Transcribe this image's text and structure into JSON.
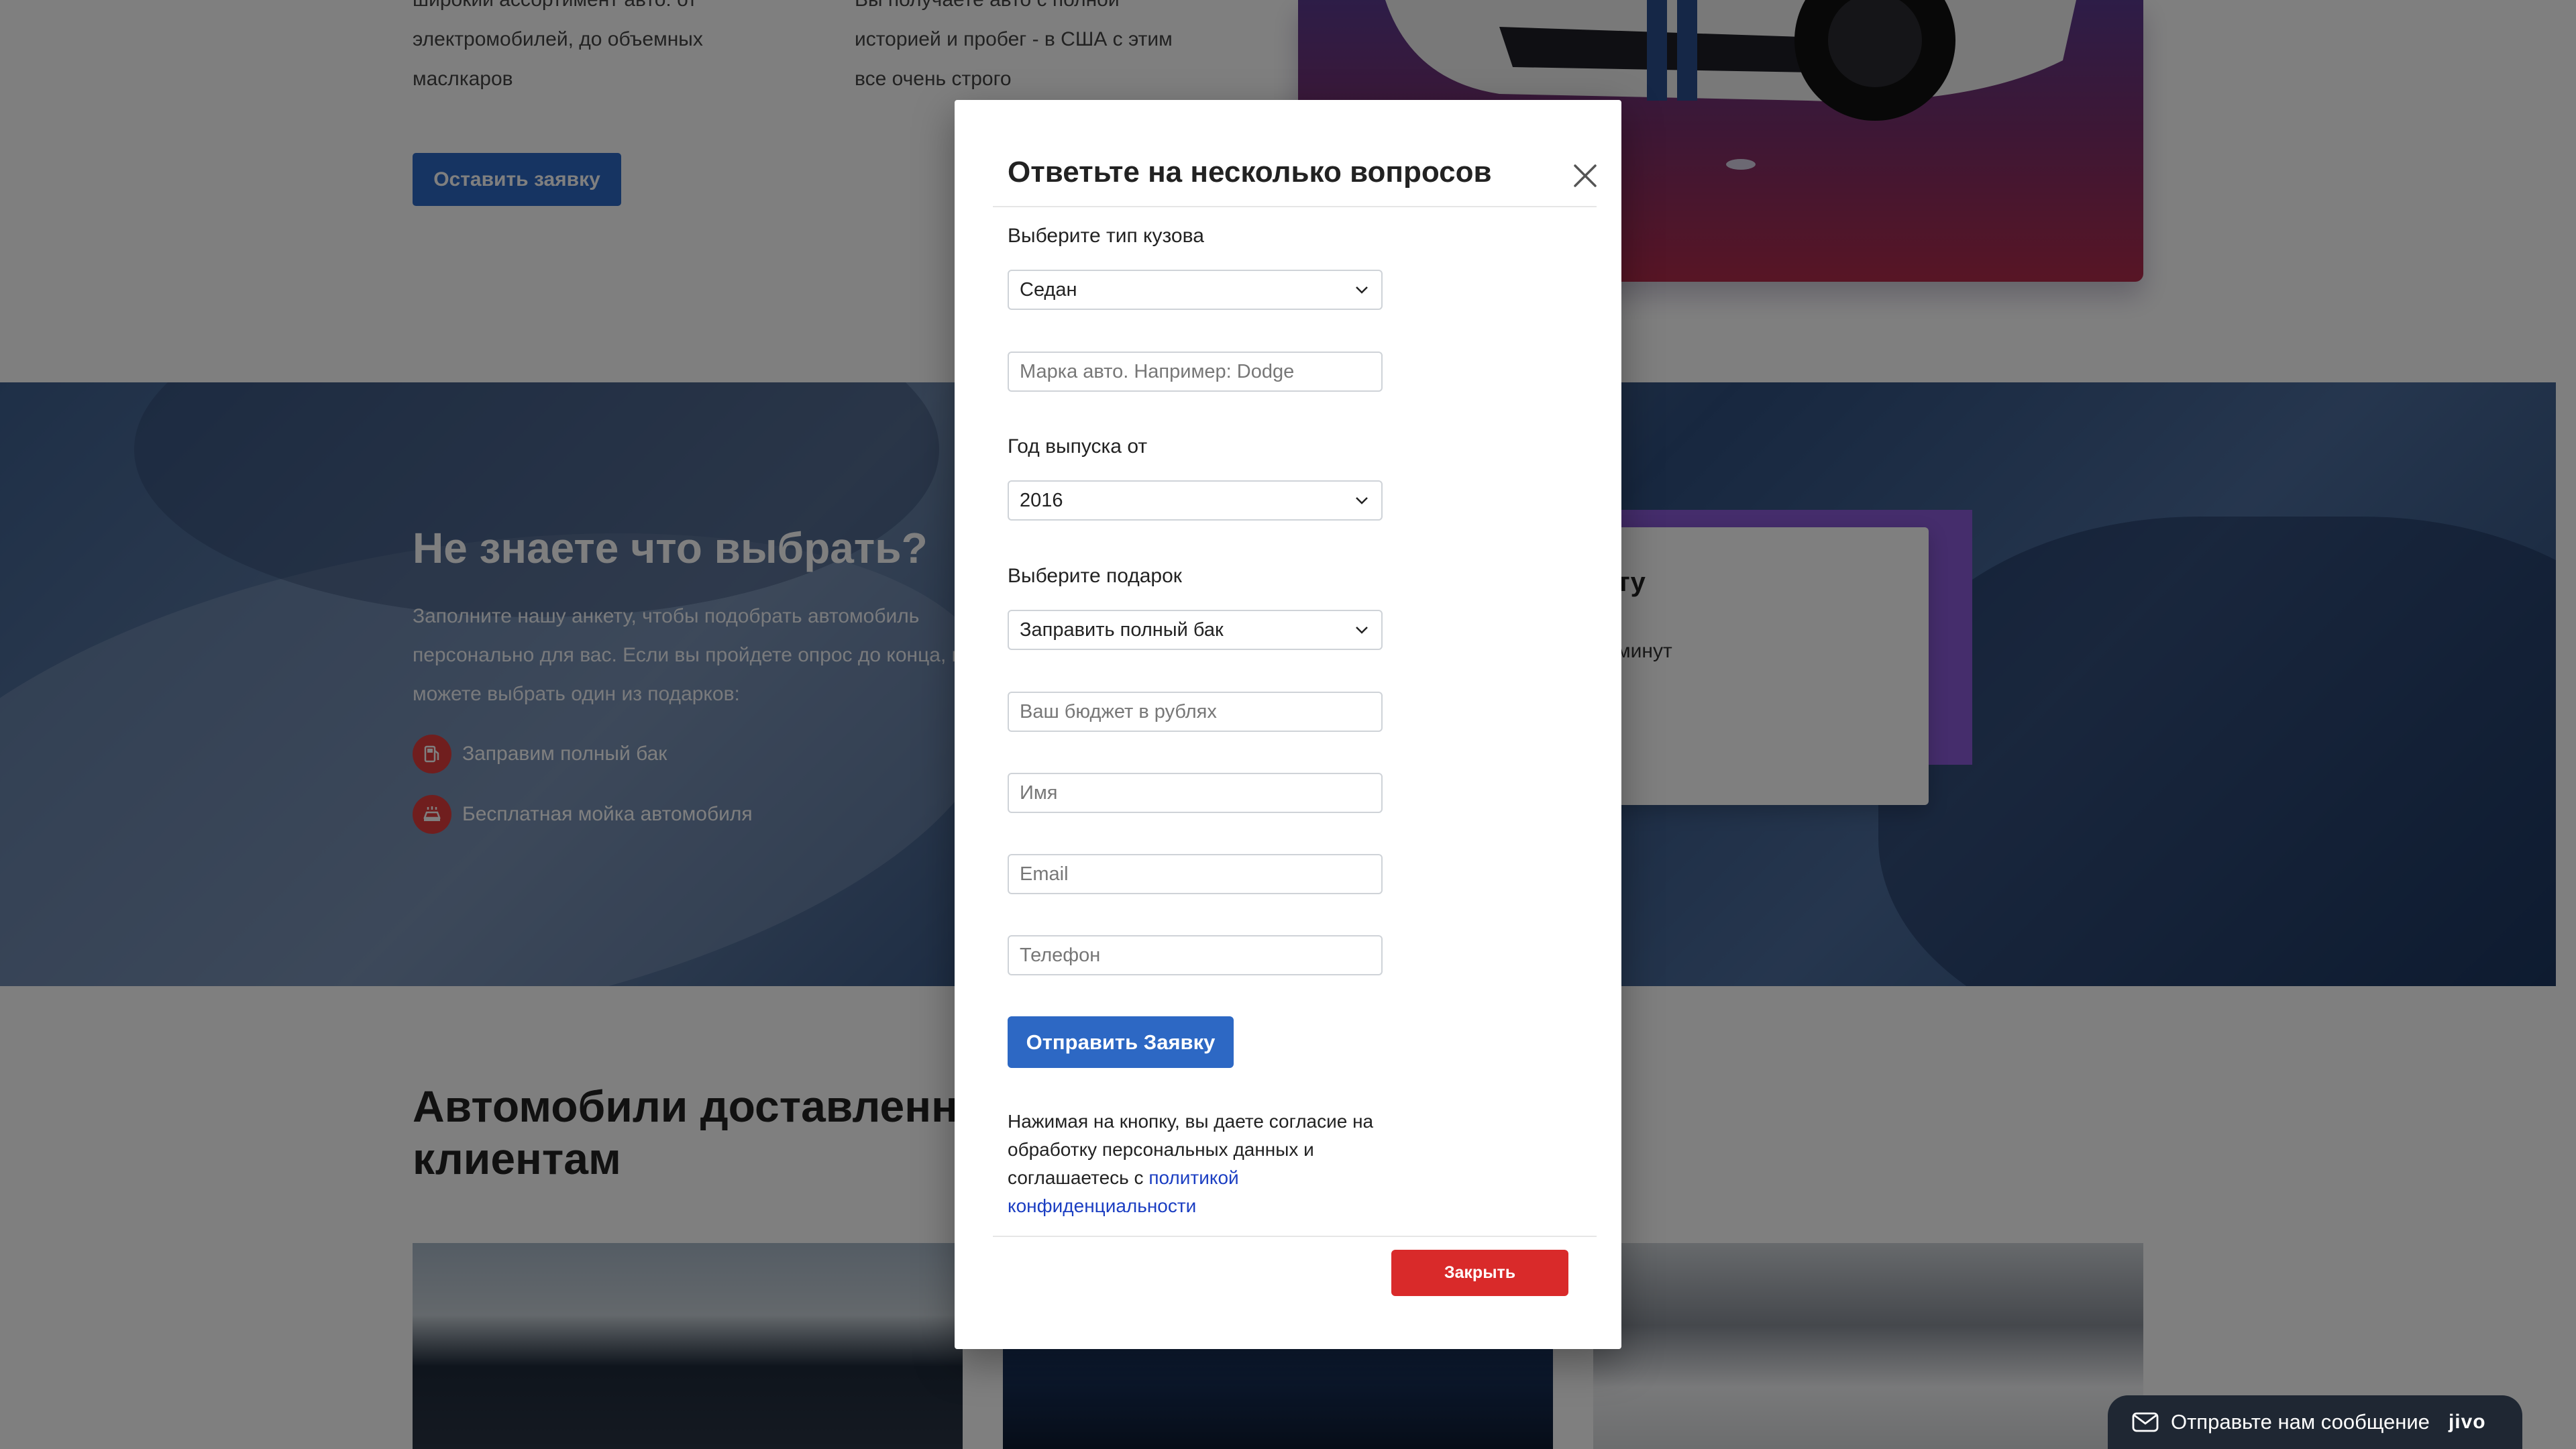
{
  "top": {
    "col1_lines": [
      "широкий ассортимент авто: от",
      "электромобилей, до объемных",
      "маслкаров"
    ],
    "col2_lines": [
      "Вы получаете авто с полной",
      "историей и пробег - в США с этим",
      "все очень строго"
    ],
    "cta_label": "Оставить заявку"
  },
  "banner": {
    "title": "Не знаете что выбрать?",
    "description": "Заполните нашу анкету, чтобы подобрать автомобиль персонально для вас. Если вы пройдете опрос до конца, вы можете выбрать один из подарков:",
    "gifts": [
      {
        "label": "Заправим полный бак",
        "icon": "fuel-icon"
      },
      {
        "label": "Бесплатная мойка автомобиля",
        "icon": "car-wash-icon"
      }
    ],
    "card": {
      "title_fragment": "ту",
      "text_fragment": "минут"
    }
  },
  "delivered": {
    "title": "Автомобили доставленные нашим клиентам"
  },
  "modal": {
    "title": "Ответьте на несколько вопросов",
    "body_type_label": "Выберите тип кузова",
    "body_type_value": "Седан",
    "brand_placeholder": "Марка авто. Например: Dodge",
    "year_label": "Год выпуска от",
    "year_value": "2016",
    "gift_label": "Выберите подарок",
    "gift_value": "Заправить полный бак",
    "budget_placeholder": "Ваш бюджет в рублях",
    "name_placeholder": "Имя",
    "email_placeholder": "Email",
    "phone_placeholder": "Телефон",
    "submit_label": "Отправить Заявку",
    "consent_text": "Нажимая на кнопку, вы даете согласие на обработку персональных данных и соглашаетесь с ",
    "consent_link": "политикой конфиденциальности",
    "close_label": "Закрыть"
  },
  "chat": {
    "label": "Отправьте нам сообщение",
    "brand": "jivo"
  },
  "colors": {
    "accent": "#2d68c4",
    "danger": "#d92a2a",
    "gift_icon": "#e03c3c",
    "chat_bg": "#1f2733"
  }
}
